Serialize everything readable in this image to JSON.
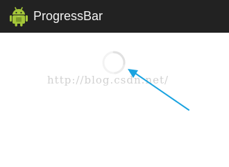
{
  "action_bar": {
    "title": "ProgressBar",
    "icon": "android-robot-icon",
    "background": "#222222",
    "title_color": "#f2f2f2"
  },
  "progress": {
    "type": "indeterminate-spinner",
    "color": "#e6e6e6"
  },
  "watermark": {
    "text": "http://blog.csdn.net/"
  },
  "annotation": {
    "type": "arrow",
    "color": "#1aa3e0"
  },
  "colors": {
    "android_green": "#a4c639",
    "arrow_blue": "#1aa3e0"
  }
}
